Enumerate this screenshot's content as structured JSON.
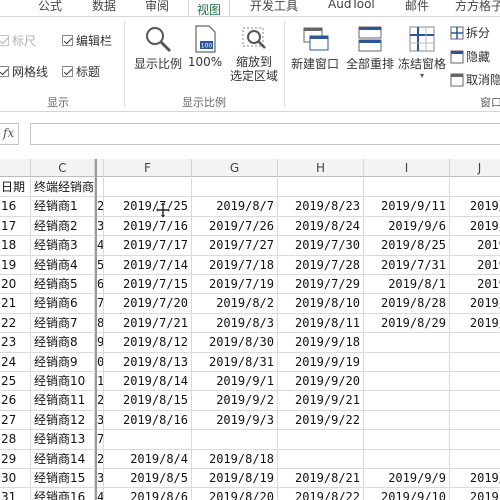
{
  "tabs": [
    "公式",
    "数据",
    "审阅",
    "视图",
    "开发工具",
    "AudTool",
    "邮件",
    "方方格子"
  ],
  "ribbon": {
    "show_group": {
      "title": "显示",
      "checks": [
        {
          "label": "标尺",
          "checked": true,
          "disabled": true
        },
        {
          "label": "编辑栏",
          "checked": true,
          "disabled": false
        },
        {
          "label": "网格线",
          "checked": true,
          "disabled": false
        },
        {
          "label": "标题",
          "checked": true,
          "disabled": false
        }
      ]
    },
    "zoom_group": {
      "title": "显示比例",
      "zoom_label": "显示比例",
      "hundred_label": "100%",
      "zoom_sel_line1": "缩放到",
      "zoom_sel_line2": "选定区域"
    },
    "window_group": {
      "title": "窗口",
      "new_window": "新建窗口",
      "arrange_all": "全部重排",
      "freeze_panes": "冻结窗格",
      "split": "拆分",
      "hide": "隐藏",
      "unhide": "取消隐"
    },
    "colors": {
      "accent": "#217346",
      "icon_blue": "#2b579a"
    }
  },
  "formula_bar": {
    "fx": "fx",
    "name_box": "",
    "value": ""
  },
  "grid": {
    "col_headers": [
      "",
      "C",
      "",
      "F",
      "G",
      "H",
      "I",
      "J"
    ],
    "header_row": [
      "日期",
      "终端经销商",
      "",
      "",
      "",
      "",
      "",
      ""
    ],
    "rows": [
      {
        "a": "16",
        "c": "经销商1",
        "d": "2",
        "f": "2019/7/25",
        "g": "2019/8/7",
        "h": "2019/8/23",
        "i": "2019/9/11",
        "j": "2019/"
      },
      {
        "a": "17",
        "c": "经销商2",
        "d": "3",
        "f": "2019/7/16",
        "g": "2019/7/26",
        "h": "2019/8/24",
        "i": "2019/9/6",
        "j": "2019/"
      },
      {
        "a": "18",
        "c": "经销商3",
        "d": "4",
        "f": "2019/7/17",
        "g": "2019/7/27",
        "h": "2019/7/30",
        "i": "2019/8/25",
        "j": "2019"
      },
      {
        "a": "19",
        "c": "经销商4",
        "d": "5",
        "f": "2019/7/14",
        "g": "2019/7/18",
        "h": "2019/7/28",
        "i": "2019/7/31",
        "j": "2019"
      },
      {
        "a": "20",
        "c": "经销商5",
        "d": "6",
        "f": "2019/7/15",
        "g": "2019/7/19",
        "h": "2019/7/29",
        "i": "2019/8/1",
        "j": "2019"
      },
      {
        "a": "21",
        "c": "经销商6",
        "d": "7",
        "f": "2019/7/20",
        "g": "2019/8/2",
        "h": "2019/8/10",
        "i": "2019/8/28",
        "j": "2019/"
      },
      {
        "a": "22",
        "c": "经销商7",
        "d": "8",
        "f": "2019/7/21",
        "g": "2019/8/3",
        "h": "2019/8/11",
        "i": "2019/8/29",
        "j": "2019/"
      },
      {
        "a": "23",
        "c": "经销商8",
        "d": "9",
        "f": "2019/8/12",
        "g": "2019/8/30",
        "h": "2019/9/18",
        "i": "",
        "j": ""
      },
      {
        "a": "24",
        "c": "经销商9",
        "d": "0",
        "f": "2019/8/13",
        "g": "2019/8/31",
        "h": "2019/9/19",
        "i": "",
        "j": ""
      },
      {
        "a": "25",
        "c": "经销商10",
        "d": "1",
        "f": "2019/8/14",
        "g": "2019/9/1",
        "h": "2019/9/20",
        "i": "",
        "j": ""
      },
      {
        "a": "26",
        "c": "经销商11",
        "d": "2",
        "f": "2019/8/15",
        "g": "2019/9/2",
        "h": "2019/9/21",
        "i": "",
        "j": ""
      },
      {
        "a": "27",
        "c": "经销商12",
        "d": "3",
        "f": "2019/8/16",
        "g": "2019/9/3",
        "h": "2019/9/22",
        "i": "",
        "j": ""
      },
      {
        "a": "28",
        "c": "经销商13",
        "d": "7",
        "f": "",
        "g": "",
        "h": "",
        "i": "",
        "j": ""
      },
      {
        "a": "29",
        "c": "经销商14",
        "d": "2",
        "f": "2019/8/4",
        "g": "2019/8/18",
        "h": "",
        "i": "",
        "j": ""
      },
      {
        "a": "30",
        "c": "经销商15",
        "d": "3",
        "f": "2019/8/5",
        "g": "2019/8/19",
        "h": "2019/8/21",
        "i": "2019/9/9",
        "j": "2019/"
      },
      {
        "a": "31",
        "c": "经销商16",
        "d": "4",
        "f": "2019/8/6",
        "g": "2019/8/20",
        "h": "2019/8/22",
        "i": "2019/9/10",
        "j": "2019/"
      }
    ]
  }
}
